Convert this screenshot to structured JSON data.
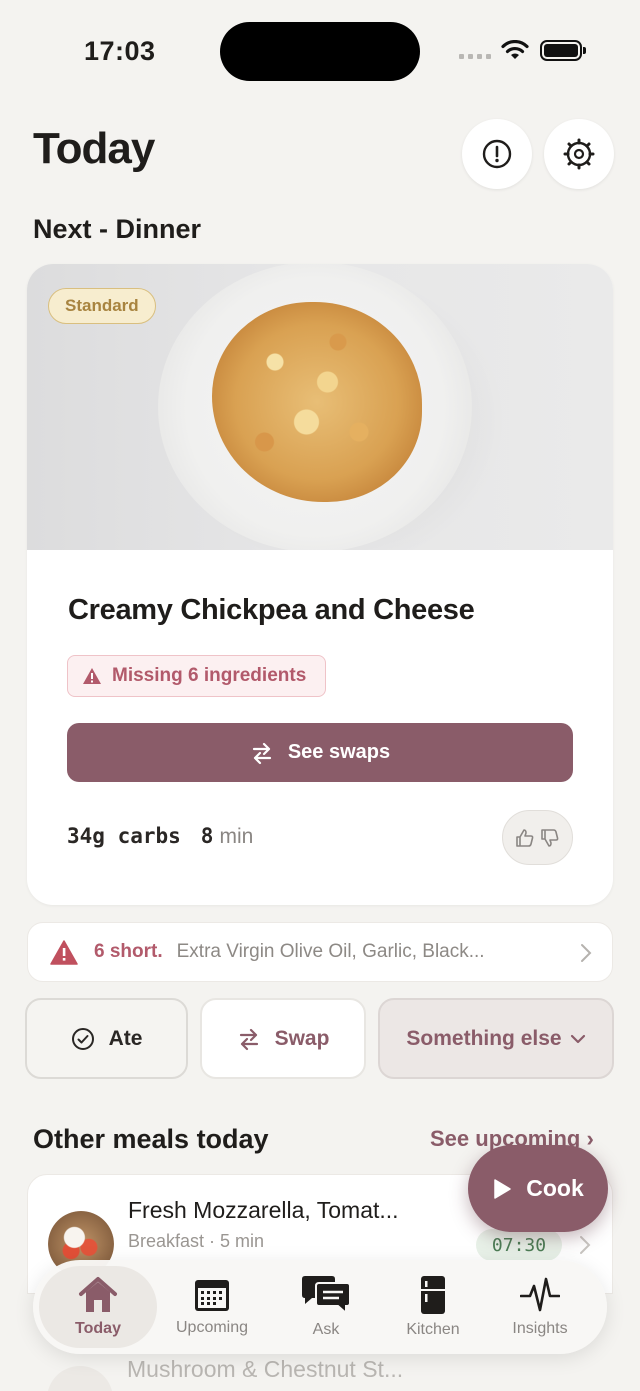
{
  "status": {
    "time": "17:03"
  },
  "header": {
    "title": "Today",
    "alert_icon": "alert-circle-icon",
    "settings_icon": "gear-icon"
  },
  "next": {
    "section_title": "Next - Dinner",
    "badge": "Standard",
    "meal_name": "Creamy Chickpea and Cheese",
    "missing_label": "Missing 6 ingredients",
    "swaps_label": "See swaps",
    "carbs": "34g carbs",
    "minutes_value": "8",
    "minutes_unit": "min"
  },
  "shortage": {
    "count_label": "6 short.",
    "ingredients": "Extra Virgin Olive Oil, Garlic, Black..."
  },
  "actions": {
    "ate": "Ate",
    "swap": "Swap",
    "something_else": "Something else"
  },
  "other": {
    "title": "Other meals today",
    "see_upcoming": "See upcoming ›",
    "meals": [
      {
        "name": "Fresh Mozzarella, Tomat...",
        "subtitle": "Breakfast · 5 min",
        "timer": "07:30"
      },
      {
        "name": "Mushroom & Chestnut St..."
      }
    ]
  },
  "cook_button": "Cook",
  "tabs": [
    {
      "label": "Today",
      "icon": "home-icon",
      "active": true
    },
    {
      "label": "Upcoming",
      "icon": "calendar-icon"
    },
    {
      "label": "Ask",
      "icon": "chat-icon"
    },
    {
      "label": "Kitchen",
      "icon": "fridge-icon"
    },
    {
      "label": "Insights",
      "icon": "pulse-icon"
    }
  ],
  "colors": {
    "accent": "#8a5c69",
    "warning": "#b25a6b",
    "background": "#f4f3f0",
    "timer_green": "#4b7d55"
  }
}
